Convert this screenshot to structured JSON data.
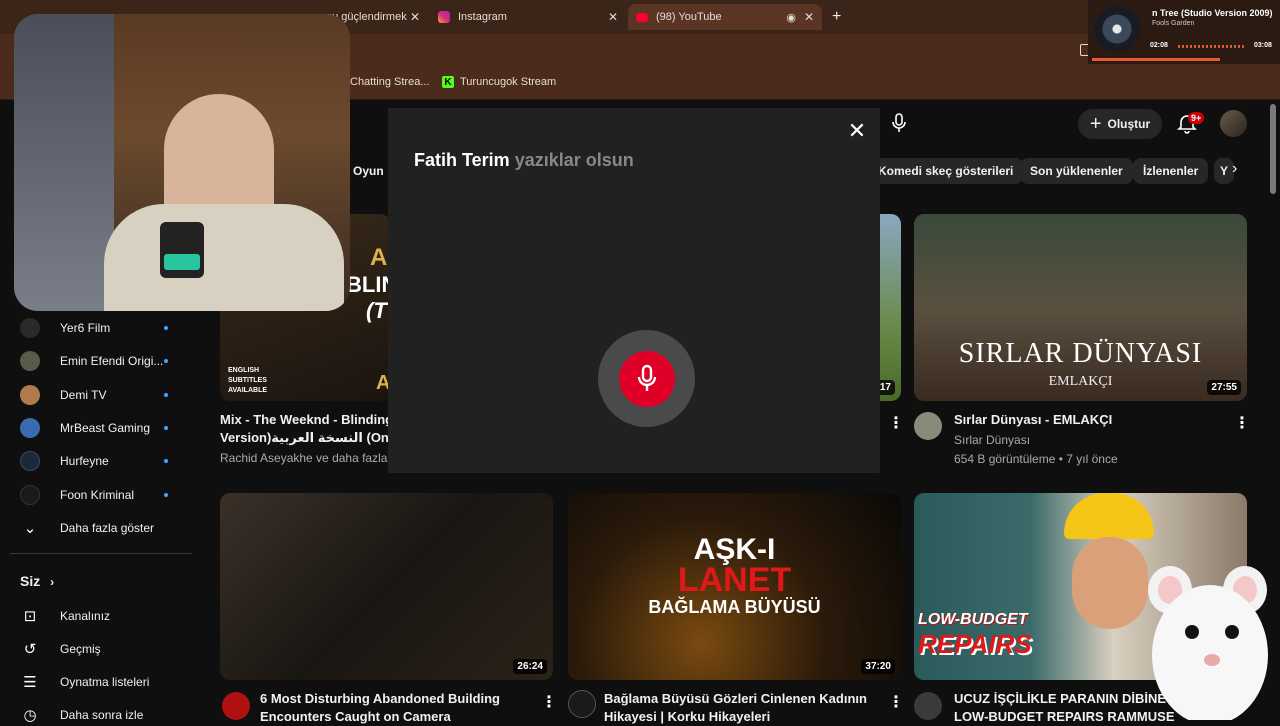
{
  "browser": {
    "tabs": [
      {
        "title": "nu güçlendirmek"
      },
      {
        "title": "Instagram"
      },
      {
        "title": "(98) YouTube"
      }
    ],
    "new_tab_icon": "plus-icon",
    "bookmarks": [
      {
        "label": "Chatting Strea..."
      },
      {
        "label": "Turuncugok Stream"
      }
    ]
  },
  "media": {
    "title": "n Tree (Studio Version 2009)",
    "artist": "Fools Garden",
    "time_elapsed": "02:08",
    "time_total": "03:08"
  },
  "header": {
    "create_label": "Oluştur",
    "notification_badge": "9+"
  },
  "chips": [
    "Oyun",
    "Komedi skeç gösterileri",
    "Son yüklenenler",
    "İzlenenler",
    "Y"
  ],
  "sidebar": {
    "subscriptions": [
      {
        "label": "Yer6 Film",
        "color": "#2a2a2a"
      },
      {
        "label": "Emin Efendi Origi...",
        "color": "#5a5a4a"
      },
      {
        "label": "Demi TV",
        "color": "#b07a4a"
      },
      {
        "label": "MrBeast Gaming",
        "color": "#3a6ab0"
      },
      {
        "label": "Hurfeyne",
        "color": "#1a2a3a"
      },
      {
        "label": "Foon Kriminal",
        "color": "#1a1a1a"
      }
    ],
    "show_more": "Daha fazla göster",
    "you_section": "Siz",
    "you_items": [
      {
        "label": "Kanalınız",
        "icon": "person-box-icon"
      },
      {
        "label": "Geçmiş",
        "icon": "history-icon"
      },
      {
        "label": "Oynatma listeleri",
        "icon": "playlist-icon"
      },
      {
        "label": "Daha sonra izle",
        "icon": "clock-icon"
      }
    ]
  },
  "videos": [
    {
      "title_line1": "Mix - The Weeknd - Blinding",
      "title_line2": "Version)النسخة العربية (On Spoti",
      "channel": "Rachid Aseyakhe ve daha fazlası",
      "thumb_text1": "A",
      "thumb_text2": "BLIN",
      "thumb_text3": "(T",
      "thumb_text4": "A",
      "thumb_text5": "ENGLISH SUBTITLES AVAILABLE"
    },
    {
      "duration": "17"
    },
    {
      "title": "Sırlar Dünyası - EMLAKÇI",
      "channel": "Sırlar Dünyası",
      "meta": "654 B görüntüleme • 7 yıl önce",
      "duration": "27:55",
      "thumb_title": "SIRLAR DÜNYASI",
      "thumb_sub": "EMLAKÇI"
    },
    {
      "title_line1": "6 Most Disturbing Abandoned Building",
      "title_line2": "Encounters Caught on Camera",
      "duration": "26:24"
    },
    {
      "title_line1": "Bağlama Büyüsü Gözleri Cinlenen Kadının",
      "title_line2": "Hikayesi | Korku Hikayeleri",
      "duration": "37:20",
      "thumb_line1": "AŞK-I",
      "thumb_line2": "LANET",
      "thumb_line3": "BAĞLAMA BÜYÜSÜ"
    },
    {
      "title_line1": "UCUZ İŞÇİLİKLE PARANIN DİBİNE V",
      "title_line2": "LOW-BUDGET REPAIRS RAMMUSE",
      "thumb_line1": "LOW-BUDGET",
      "thumb_line2": "REPAIRS"
    }
  ],
  "voice_search": {
    "recognized": "Fatih Terim",
    "pending": "yazıklar olsun"
  }
}
